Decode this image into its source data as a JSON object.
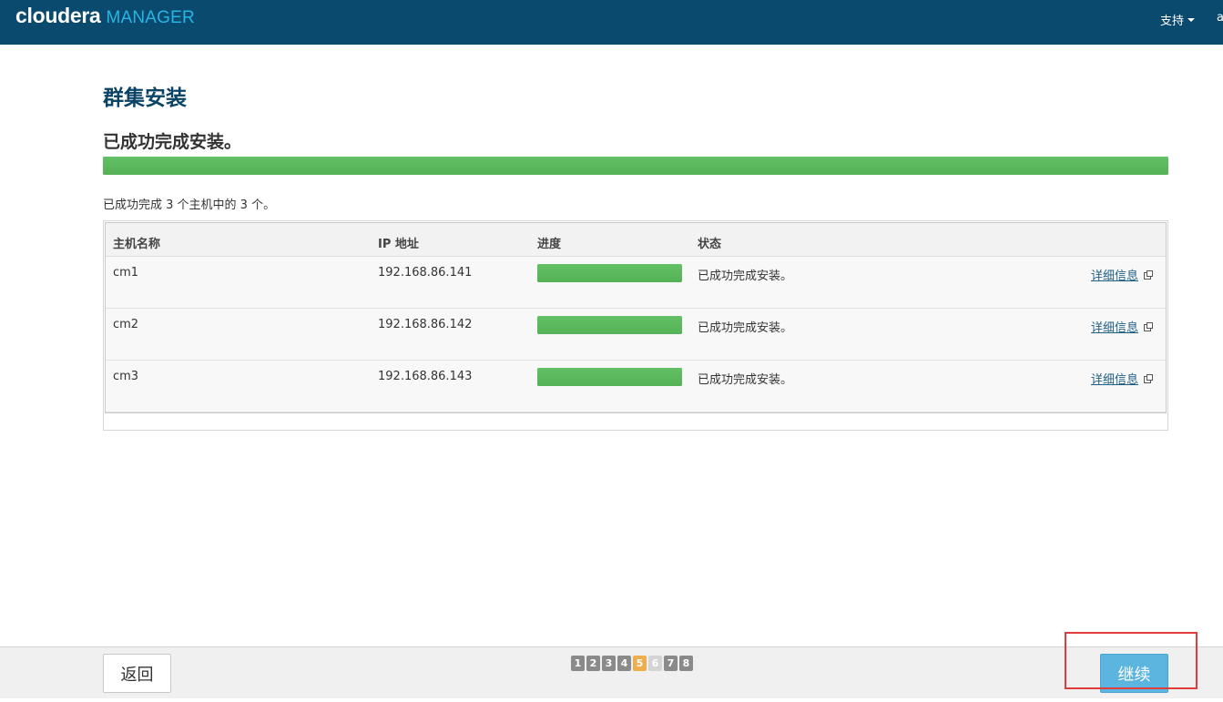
{
  "header": {
    "brand": "cloudera",
    "product": "MANAGER",
    "support_label": "支持",
    "user_label": "a"
  },
  "page": {
    "title": "群集安装",
    "status_heading": "已成功完成安装。",
    "overall_progress_percent": 100,
    "summary": "已成功完成 3 个主机中的 3 个。"
  },
  "table": {
    "headers": {
      "host": "主机名称",
      "ip": "IP 地址",
      "progress": "进度",
      "status": "状态"
    },
    "rows": [
      {
        "host": "cm1",
        "ip": "192.168.86.141",
        "progress_percent": 100,
        "status": "已成功完成安装。",
        "link": "详细信息"
      },
      {
        "host": "cm2",
        "ip": "192.168.86.142",
        "progress_percent": 100,
        "status": "已成功完成安装。",
        "link": "详细信息"
      },
      {
        "host": "cm3",
        "ip": "192.168.86.143",
        "progress_percent": 100,
        "status": "已成功完成安装。",
        "link": "详细信息"
      }
    ]
  },
  "footer": {
    "back_label": "返回",
    "continue_label": "继续",
    "steps": [
      "1",
      "2",
      "3",
      "4",
      "5",
      "6",
      "7",
      "8"
    ],
    "current_step": "5"
  },
  "colors": {
    "topbar": "#0a4a6e",
    "brand_accent": "#27b5e3",
    "progress_fill": "#5cb85c",
    "current_step": "#f0ad4e",
    "continue_button": "#5bb5de",
    "highlight": "#e23b3b"
  }
}
